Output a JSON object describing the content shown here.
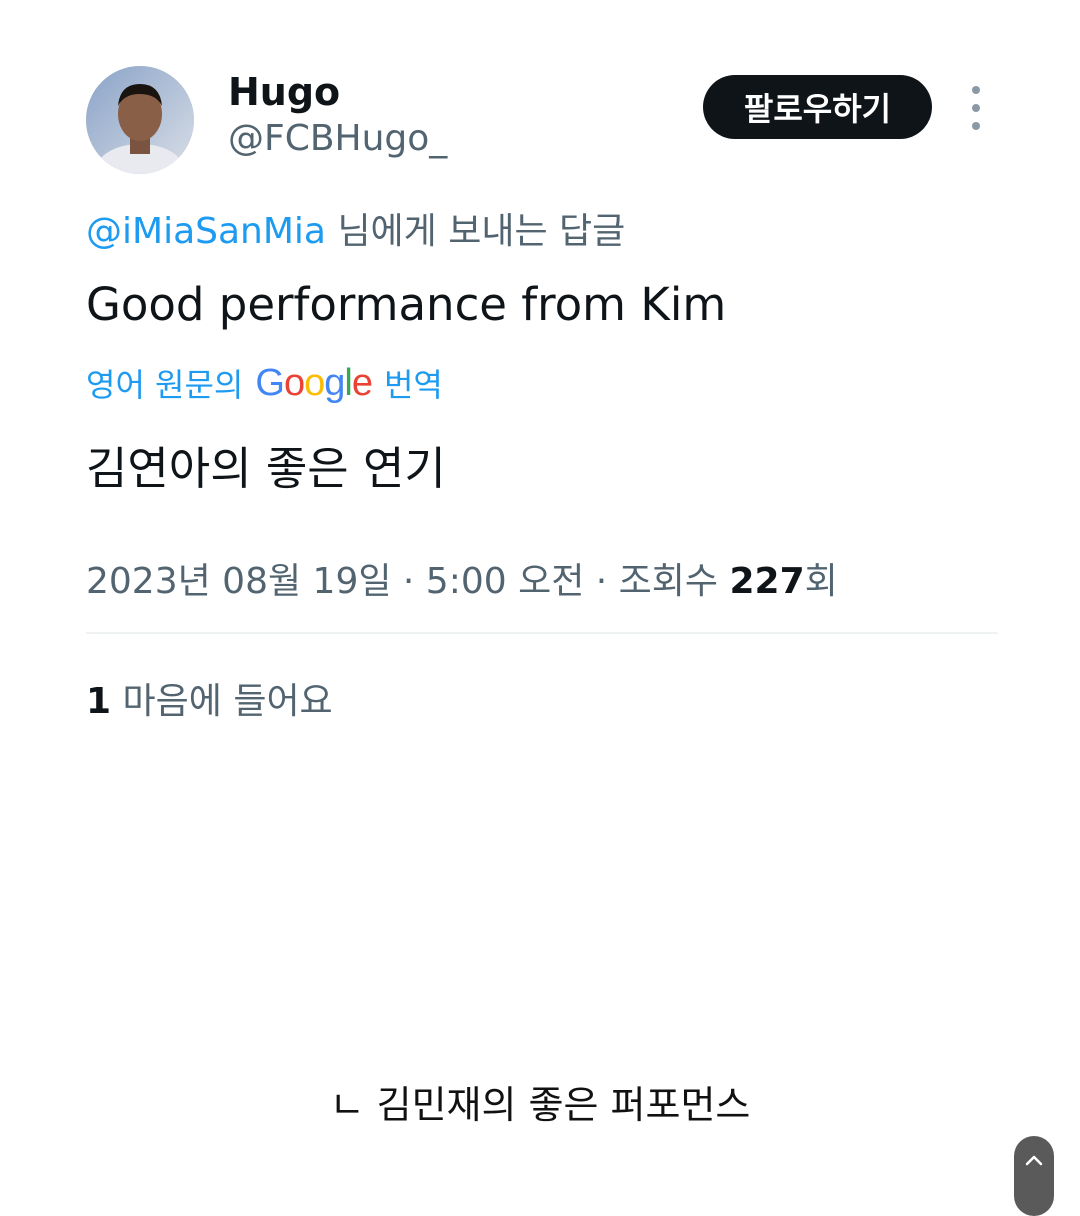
{
  "tweet": {
    "display_name": "Hugo",
    "handle": "@FCBHugo_",
    "follow_label": "팔로우하기",
    "more_icon": "more-vertical-icon",
    "reply_to_handle": "@iMiaSanMia",
    "reply_to_suffix": "님에게 보내는 답글",
    "text": "Good performance from Kim",
    "translate_prefix": "영어 원문의",
    "translate_brand": "Google",
    "translate_suffix": "번역",
    "translated_text": "김연아의 좋은 연기",
    "timestamp": "2023년 08월 19일 · 5:00 오전 · 조회수",
    "views_count": "227",
    "views_suffix": "회",
    "likes_count": "1",
    "likes_label": "마음에 들어요"
  },
  "caption": "ㄴ 김민재의 좋은 퍼포먼스",
  "colors": {
    "accent": "#1d9bf0",
    "secondary_text": "#536471",
    "primary_text": "#0f1419",
    "google_blue": "#4285F4",
    "google_red": "#EA4335",
    "google_yellow": "#FBBC05",
    "google_green": "#34A853"
  },
  "icons": {
    "scroll_top": "chevron-up-icon",
    "avatar": "avatar-photo"
  }
}
